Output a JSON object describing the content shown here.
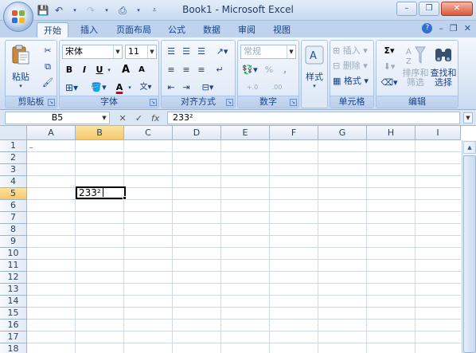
{
  "window": {
    "title": "Book1 - Microsoft Excel",
    "controls": {
      "minimize": "–",
      "restore": "❐",
      "close": "✕"
    }
  },
  "quick_access": [
    "save-icon",
    "undo-icon",
    "redo-icon",
    "print-preview-icon",
    "customize-icon"
  ],
  "tabs": [
    {
      "label": "开始",
      "active": true
    },
    {
      "label": "插入",
      "active": false
    },
    {
      "label": "页面布局",
      "active": false
    },
    {
      "label": "公式",
      "active": false
    },
    {
      "label": "数据",
      "active": false
    },
    {
      "label": "审阅",
      "active": false
    },
    {
      "label": "视图",
      "active": false
    }
  ],
  "ribbon": {
    "clipboard": {
      "label": "剪贴板",
      "paste": "粘贴"
    },
    "font": {
      "label": "字体",
      "name": "宋体",
      "size": "11",
      "bold": "B",
      "italic": "I",
      "underline": "U",
      "grow": "A",
      "shrink": "A",
      "font_color_letter": "A",
      "accent": "#d0021b"
    },
    "alignment": {
      "label": "对齐方式"
    },
    "number": {
      "label": "数字",
      "format": "常规",
      "percent": "%",
      "comma": ",",
      "inc_decimal": "+.0",
      "dec_decimal": ".00"
    },
    "styles": {
      "label": "样式"
    },
    "cells": {
      "label": "单元格",
      "insert": "插入",
      "delete": "删除",
      "format": "格式"
    },
    "editing": {
      "label": "编辑",
      "sort": "排序和",
      "filter": "筛选",
      "find": "查找和",
      "select": "选择"
    }
  },
  "formula_bar": {
    "name_box": "B5",
    "fx": "fx",
    "cancel": "✕",
    "enter": "✓",
    "value": "233²"
  },
  "sheet": {
    "columns": [
      "A",
      "B",
      "C",
      "D",
      "E",
      "F",
      "G",
      "H",
      "I"
    ],
    "rows": [
      "1",
      "2",
      "3",
      "4",
      "5",
      "6",
      "7",
      "8",
      "9",
      "10",
      "11",
      "12",
      "13",
      "14",
      "15",
      "16",
      "17",
      "18"
    ],
    "selected_column": "B",
    "selected_row": "5",
    "active_cell_value": "233²"
  }
}
